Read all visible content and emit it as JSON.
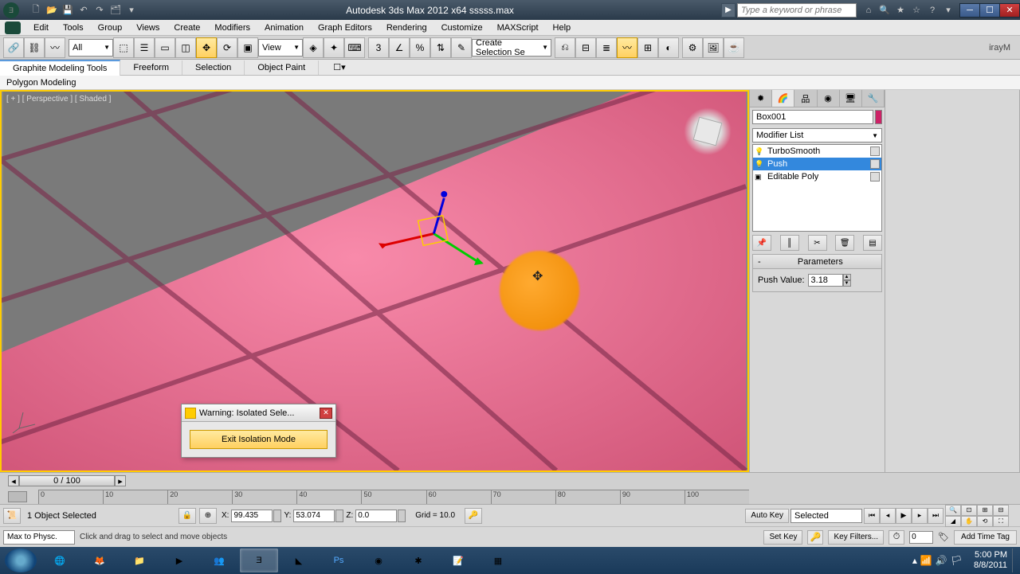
{
  "title": "Autodesk 3ds Max  2012 x64     sssss.max",
  "search_placeholder": "Type a keyword or phrase",
  "menus": [
    "Edit",
    "Tools",
    "Group",
    "Views",
    "Create",
    "Modifiers",
    "Animation",
    "Graph Editors",
    "Rendering",
    "Customize",
    "MAXScript",
    "Help"
  ],
  "toolbar": {
    "all_dropdown": "All",
    "view_dropdown": "View",
    "selset_dropdown": "Create Selection Se",
    "renderer": "irayM"
  },
  "ribbon": {
    "tabs": [
      "Graphite Modeling Tools",
      "Freeform",
      "Selection",
      "Object Paint"
    ],
    "sub": "Polygon Modeling"
  },
  "viewport": {
    "label": "[ + ] [ Perspective ] [ Shaded ]"
  },
  "iso_dialog": {
    "title": "Warning: Isolated Sele...",
    "button": "Exit Isolation Mode"
  },
  "cmd_panel": {
    "object_name": "Box001",
    "modifier_list": "Modifier List",
    "stack": [
      "TurboSmooth",
      "Push",
      "Editable Poly"
    ],
    "rollout_title": "Parameters",
    "push_label": "Push Value:",
    "push_value": "3.18"
  },
  "timeslider": {
    "frame_label": "0 / 100",
    "ticks": [
      "0",
      "10",
      "20",
      "30",
      "40",
      "50",
      "60",
      "70",
      "80",
      "90",
      "100"
    ]
  },
  "status": {
    "selection": "1 Object Selected",
    "x": "99.435",
    "y": "53.074",
    "z": "0.0",
    "grid": "Grid = 10.0",
    "autokey": "Auto Key",
    "setkey": "Set Key",
    "selected_dd": "Selected",
    "keyfilters": "Key Filters...",
    "frame_input": "0"
  },
  "prompt": {
    "maxscript": "Max to Physc.",
    "text": "Click and drag to select and move objects",
    "time_tag": "Add Time Tag"
  },
  "taskbar": {
    "time": "5:00 PM",
    "date": "8/8/2011"
  }
}
